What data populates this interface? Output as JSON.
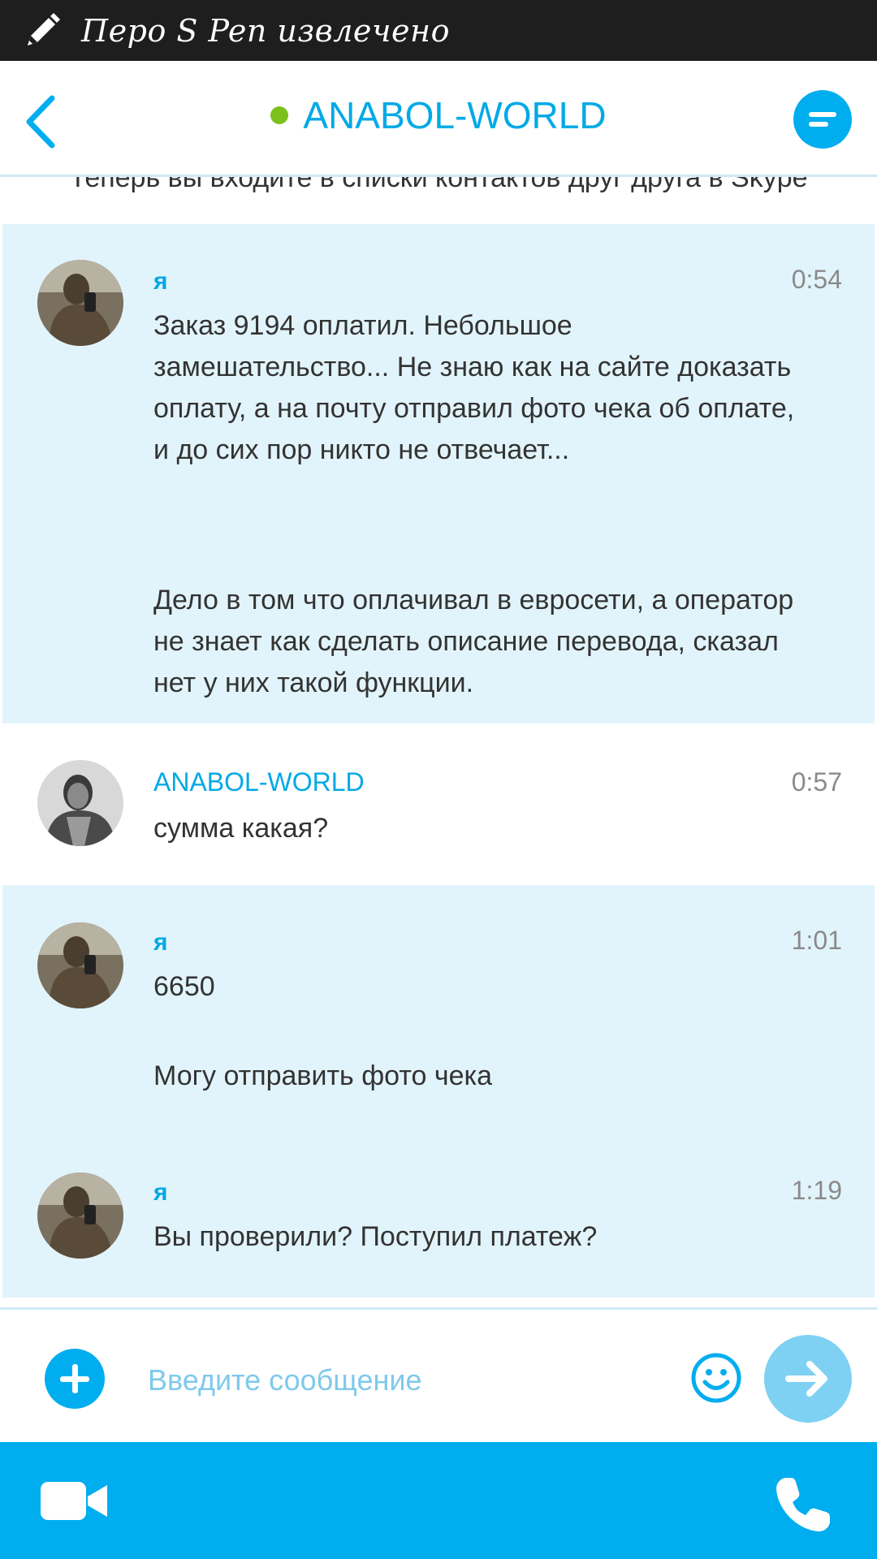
{
  "status_bar": {
    "text": "Перо S Pen извлечено",
    "icon": "pen-icon"
  },
  "header": {
    "title": "ANABOL-WORLD",
    "online": true,
    "back_icon": "back-chevron-icon",
    "menu_icon": "menu-icon"
  },
  "chat": {
    "system_message": "Теперь вы входите в списки контактов друг друга в Skype",
    "messages": [
      {
        "sender": "я",
        "time": "0:54",
        "paragraphs": [
          "Заказ 9194 оплатил. Небольшое замешательство... Не знаю как на сайте доказать оплату,  а на почту отправил фото чека об оплате,  и до сих пор никто не отвечает...",
          "Дело в том что оплачивал в евросети,  а оператор не знает как сделать описание перевода,  сказал нет у них такой функции."
        ]
      },
      {
        "sender": "ANABOL-WORLD",
        "time": "0:57",
        "paragraphs": [
          "сумма какая?"
        ]
      },
      {
        "sender": "я",
        "time": "1:01",
        "paragraphs": [
          "6650",
          "Могу отправить фото чека"
        ]
      },
      {
        "sender": "я",
        "time": "1:19",
        "paragraphs": [
          "Вы проверили?  Поступил платеж?"
        ]
      }
    ]
  },
  "composer": {
    "placeholder": "Введите сообщение",
    "add_icon": "plus-icon",
    "emoji_icon": "emoji-icon",
    "send_icon": "send-arrow-icon"
  },
  "bottom_bar": {
    "video_icon": "video-call-icon",
    "call_icon": "phone-icon"
  },
  "colors": {
    "accent": "#00adef",
    "mine_bg": "#e2f4fb",
    "online": "#7cc11b",
    "status_bar": "#1e1e1e"
  }
}
